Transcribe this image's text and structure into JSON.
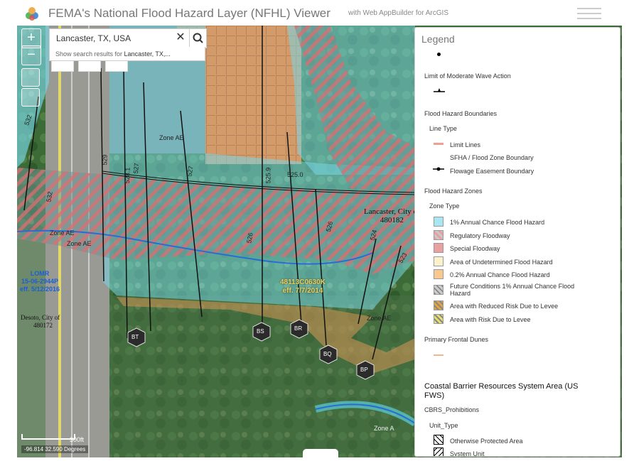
{
  "header": {
    "title": "FEMA's National Flood Hazard Layer (NFHL) Viewer",
    "subtitle": "with Web AppBuilder for ArcGIS"
  },
  "map": {
    "zoom_in_label": "+",
    "zoom_out_label": "−",
    "search": {
      "value": "Lancaster, TX, USA",
      "suggestion_prefix": "Show search results for ",
      "suggestion_query": "Lancaster, TX,..."
    },
    "labels": {
      "zone_ae_1": "Zone AE",
      "zone_ae_2": "Zone AE",
      "zone_ae_3": "Zone AE",
      "zone_ae_4": "Zone AE",
      "zone_a": "Zone A",
      "lancaster": "Lancaster, City of",
      "lancaster_id": "480182",
      "desoto": "Desoto, City of",
      "desoto_id": "480172",
      "lomr_id": "LOMR",
      "lomr_case": "15-06-2944P",
      "lomr_eff": "eff. 5/12/2016",
      "panel_id": "48113C0630K",
      "panel_eff": "eff. 7/7/2014",
      "bfe_532a": "532",
      "bfe_532b": "532",
      "bfe_529": "529",
      "bfe_528": "528.1",
      "bfe_527": "527",
      "bfe_526": "526",
      "bfe_525": "525.9",
      "bfe_5250": "525.0",
      "bfe_526b": "526",
      "bfe_524": "524",
      "bfe_523": "523",
      "xs_bt": "BT",
      "xs_bs": "BS",
      "xs_br": "BR",
      "xs_bq": "BQ",
      "xs_bp": "BP"
    },
    "scale_label": "300ft",
    "coordinates": "-96.814 32.590 Degrees"
  },
  "legend": {
    "title": "Legend",
    "limit_moderate_wave": "Limit of Moderate Wave Action",
    "flood_hazard_boundaries": "Flood Hazard Boundaries",
    "line_type": "Line Type",
    "limit_lines": "Limit Lines",
    "sfha_boundary": "SFHA / Flood Zone Boundary",
    "flowage_easement": "Flowage Easement Boundary",
    "flood_hazard_zones": "Flood Hazard Zones",
    "zone_type": "Zone Type",
    "zones": [
      {
        "label": "1% Annual Chance Flood Hazard",
        "color": "#a8e6f2"
      },
      {
        "label": "Regulatory Floodway",
        "color": "#e8a0a0"
      },
      {
        "label": "Special Floodway",
        "color": "#e8a0a0"
      },
      {
        "label": "Area of Undetermined Flood Hazard",
        "color": "#fbf2cc"
      },
      {
        "label": "0.2% Annual Chance Flood Hazard",
        "color": "#f9c88e"
      },
      {
        "label": "Future Conditions 1% Annual Chance Flood Hazard",
        "color": "#b5b5b5"
      },
      {
        "label": "Area with Reduced Risk Due to Levee",
        "color": "#e8a43c"
      },
      {
        "label": "Area with Risk Due to Levee",
        "color": "#e8e06a"
      }
    ],
    "primary_frontal_dunes": "Primary Frontal Dunes",
    "cbrs_title": "Coastal Barrier Resources System Area (US FWS)",
    "cbrs_prohibitions": "CBRS_Prohibitions",
    "unit_type": "Unit_Type",
    "otherwise_protected": "Otherwise Protected Area",
    "system_unit": "System Unit"
  }
}
